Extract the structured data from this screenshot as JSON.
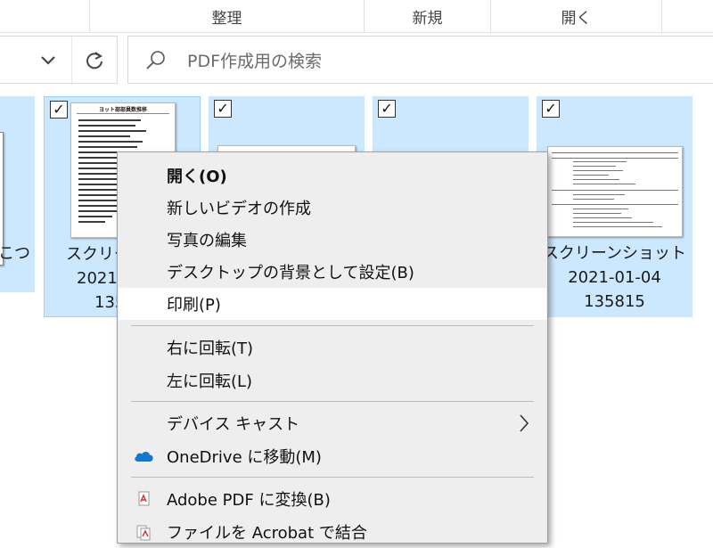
{
  "ribbon": {
    "groups": [
      "整理",
      "新規",
      "開く"
    ]
  },
  "address": {
    "chevron_icon": "chevron-down-icon",
    "refresh_icon": "refresh-icon"
  },
  "search": {
    "icon": "search-icon",
    "placeholder": "PDF作成用の検索"
  },
  "tiles": [
    {
      "label_lines": [
        "こつ"
      ]
    },
    {
      "label_lines": [
        "スクリー",
        "2021",
        "135"
      ],
      "checked": true,
      "thumb_title": "ヨット部部員数推移"
    },
    {
      "label_lines": [],
      "checked": true
    },
    {
      "label_lines": [],
      "checked": true
    },
    {
      "label_lines": [
        "スクリーンショット",
        "2021-01-04",
        "135815"
      ],
      "checked": true
    }
  ],
  "context_menu": {
    "items": [
      {
        "label": "開く(O)",
        "bold": true
      },
      {
        "label": "新しいビデオの作成"
      },
      {
        "label": "写真の編集"
      },
      {
        "label": "デスクトップの背景として設定(B)"
      },
      {
        "label": "印刷(P)",
        "highlighted": true
      },
      {
        "label": "右に回転(T)"
      },
      {
        "label": "左に回転(L)"
      },
      {
        "label": "デバイス キャスト",
        "submenu": true
      },
      {
        "label": "OneDrive に移動(M)",
        "icon": "onedrive-cloud-icon"
      },
      {
        "label": "Adobe PDF に変換(B)",
        "icon": "adobe-pdf-icon"
      },
      {
        "label": "ファイルを Acrobat で結合",
        "icon": "acrobat-combine-icon"
      }
    ]
  },
  "colors": {
    "selection_bg": "#cce8ff",
    "selection_border": "#99d1ff",
    "menu_bg": "#eeeeee",
    "menu_highlight": "#ffffff",
    "onedrive_blue": "#0f78d4",
    "adobe_red": "#d32f2f"
  }
}
